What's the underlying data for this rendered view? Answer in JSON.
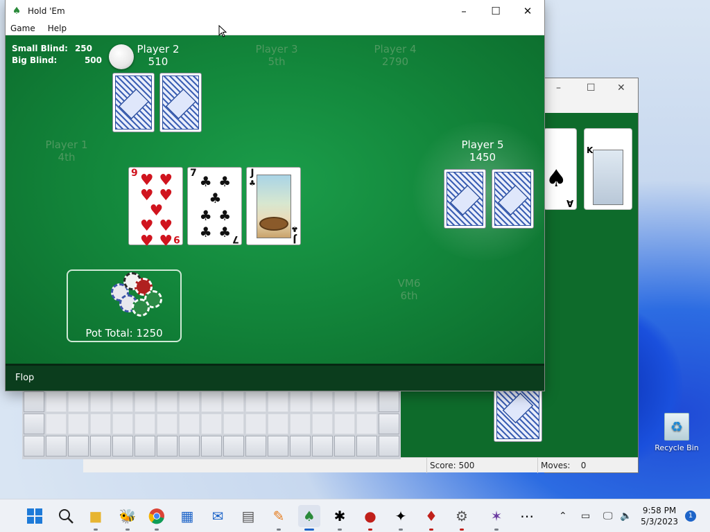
{
  "window": {
    "title": "Hold 'Em",
    "menu": [
      "Game",
      "Help"
    ]
  },
  "table": {
    "blinds": {
      "small_label": "Small Blind:",
      "small_value": "250",
      "big_label": "Big Blind:",
      "big_value": "500"
    },
    "players": [
      {
        "name": "Player 2",
        "stat": "510",
        "state": "active"
      },
      {
        "name": "Player 3",
        "stat": "5th",
        "state": "out"
      },
      {
        "name": "Player 4",
        "stat": "2790",
        "state": "folded"
      },
      {
        "name": "Player 1",
        "stat": "4th",
        "state": "out"
      },
      {
        "name": "Player 5",
        "stat": "1450",
        "state": "active"
      },
      {
        "name": "VM6",
        "stat": "6th",
        "state": "out"
      }
    ],
    "community_cards": [
      {
        "rank": "9",
        "suit": "♥",
        "color": "red"
      },
      {
        "rank": "7",
        "suit": "♣",
        "color": "black"
      },
      {
        "rank": "J",
        "suit": "♣",
        "color": "black"
      }
    ],
    "pot_label": "Pot Total: 1250",
    "status": "Flop"
  },
  "solitaire": {
    "score": "Score: 500",
    "moves": "Moves:",
    "moves_value": "0",
    "card_ranks": [
      "A",
      "K"
    ]
  },
  "desktop": {
    "recycle_bin": "Recycle Bin"
  },
  "taskbar": {
    "time": "9:58 PM",
    "date": "5/3/2023",
    "notifications": "1",
    "apps": [
      "start",
      "search",
      "file-explorer",
      "bee",
      "chrome",
      "store",
      "mail",
      "calculator",
      "paint",
      "hold-em",
      "minesweeper",
      "ladybug",
      "spider",
      "cards",
      "gear",
      "spider-solitaire",
      "more"
    ]
  },
  "colors": {
    "felt": "#13883c",
    "status_bar": "#0b3d1d",
    "taskbar_accent": "#1d64c8"
  }
}
